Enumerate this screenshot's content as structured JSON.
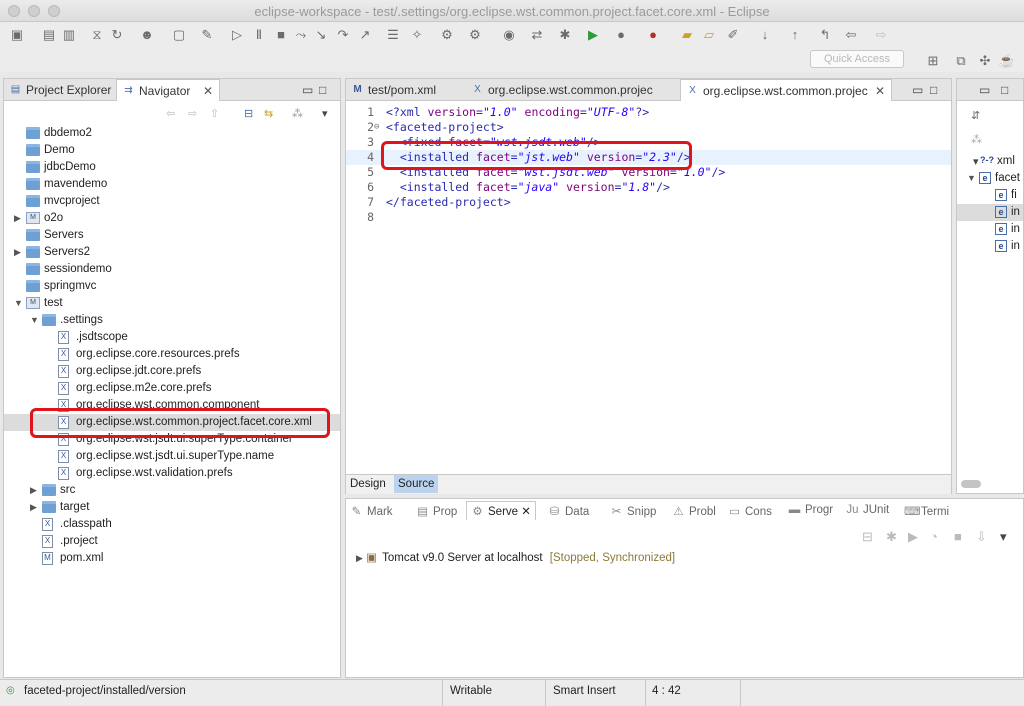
{
  "window": {
    "title": "eclipse-workspace - test/.settings/org.eclipse.wst.common.project.facet.core.xml - Eclipse"
  },
  "toolbar": {
    "quick_access_placeholder": "Quick Access"
  },
  "left_panel": {
    "tabs": [
      {
        "label": "Project Explorer",
        "active": false
      },
      {
        "label": "Navigator",
        "active": true
      }
    ],
    "tree": [
      {
        "label": "dbdemo2",
        "type": "folder",
        "indent": 0,
        "expanded": null
      },
      {
        "label": "Demo",
        "type": "folder",
        "indent": 0,
        "expanded": null
      },
      {
        "label": "jdbcDemo",
        "type": "folder",
        "indent": 0,
        "expanded": null
      },
      {
        "label": "mavendemo",
        "type": "folder",
        "indent": 0,
        "expanded": null
      },
      {
        "label": "mvcproject",
        "type": "folder",
        "indent": 0,
        "expanded": null
      },
      {
        "label": "o2o",
        "type": "project",
        "indent": 0,
        "expanded": false
      },
      {
        "label": "Servers",
        "type": "folder",
        "indent": 0,
        "expanded": null
      },
      {
        "label": "Servers2",
        "type": "folder",
        "indent": 0,
        "expanded": false
      },
      {
        "label": "sessiondemo",
        "type": "folder",
        "indent": 0,
        "expanded": null
      },
      {
        "label": "springmvc",
        "type": "folder",
        "indent": 0,
        "expanded": null
      },
      {
        "label": "test",
        "type": "project",
        "indent": 0,
        "expanded": true
      },
      {
        "label": ".settings",
        "type": "folder",
        "indent": 1,
        "expanded": true
      },
      {
        "label": ".jsdtscope",
        "type": "file",
        "indent": 2,
        "expanded": null
      },
      {
        "label": "org.eclipse.core.resources.prefs",
        "type": "file",
        "indent": 2,
        "expanded": null
      },
      {
        "label": "org.eclipse.jdt.core.prefs",
        "type": "file",
        "indent": 2,
        "expanded": null
      },
      {
        "label": "org.eclipse.m2e.core.prefs",
        "type": "file",
        "indent": 2,
        "expanded": null
      },
      {
        "label": "org.eclipse.wst.common.component",
        "type": "file",
        "indent": 2,
        "expanded": null
      },
      {
        "label": "org.eclipse.wst.common.project.facet.core.xml",
        "type": "file",
        "indent": 2,
        "expanded": null,
        "selected": true
      },
      {
        "label": "org.eclipse.wst.jsdt.ui.superType.container",
        "type": "file",
        "indent": 2,
        "expanded": null
      },
      {
        "label": "org.eclipse.wst.jsdt.ui.superType.name",
        "type": "file",
        "indent": 2,
        "expanded": null
      },
      {
        "label": "org.eclipse.wst.validation.prefs",
        "type": "file",
        "indent": 2,
        "expanded": null
      },
      {
        "label": "src",
        "type": "folder",
        "indent": 1,
        "expanded": false
      },
      {
        "label": "target",
        "type": "folder",
        "indent": 1,
        "expanded": false
      },
      {
        "label": ".classpath",
        "type": "file",
        "indent": 1,
        "expanded": null
      },
      {
        "label": ".project",
        "type": "file",
        "indent": 1,
        "expanded": null
      },
      {
        "label": "pom.xml",
        "type": "file",
        "indent": 1,
        "expanded": null
      }
    ]
  },
  "editor": {
    "tabs": [
      {
        "label": "test/pom.xml",
        "active": false
      },
      {
        "label": "org.eclipse.wst.common.projec",
        "active": false
      },
      {
        "label": "org.eclipse.wst.common.projec",
        "active": true
      }
    ],
    "lines": [
      {
        "n": "1",
        "parts": [
          [
            "tag",
            "<?xml "
          ],
          [
            "attr",
            "version"
          ],
          [
            "tag",
            "="
          ],
          [
            "val",
            "\"1.0\""
          ],
          [
            "tag",
            " "
          ],
          [
            "attr",
            "encoding"
          ],
          [
            "tag",
            "="
          ],
          [
            "val",
            "\"UTF-8\""
          ],
          [
            "tag",
            "?>"
          ]
        ]
      },
      {
        "n": "2",
        "parts": [
          [
            "tag",
            "<faceted-project>"
          ]
        ]
      },
      {
        "n": "3",
        "parts": [
          [
            "tag",
            "  <fixed "
          ],
          [
            "attr",
            "facet"
          ],
          [
            "tag",
            "="
          ],
          [
            "val",
            "\"wst.jsdt.web\""
          ],
          [
            "tag",
            "/>"
          ]
        ]
      },
      {
        "n": "4",
        "parts": [
          [
            "tag",
            "  <installed "
          ],
          [
            "attr",
            "facet"
          ],
          [
            "tag",
            "="
          ],
          [
            "val",
            "\"jst.web\""
          ],
          [
            "tag",
            " "
          ],
          [
            "attr",
            "version"
          ],
          [
            "tag",
            "="
          ],
          [
            "val",
            "\"2.3\""
          ],
          [
            "tag",
            "/>"
          ]
        ]
      },
      {
        "n": "5",
        "parts": [
          [
            "tag",
            "  <installed "
          ],
          [
            "attr",
            "facet"
          ],
          [
            "tag",
            "="
          ],
          [
            "val",
            "\"wst.jsdt.web\""
          ],
          [
            "tag",
            " "
          ],
          [
            "attr",
            "version"
          ],
          [
            "tag",
            "="
          ],
          [
            "val",
            "\"1.0\""
          ],
          [
            "tag",
            "/>"
          ]
        ]
      },
      {
        "n": "6",
        "parts": [
          [
            "tag",
            "  <installed "
          ],
          [
            "attr",
            "facet"
          ],
          [
            "tag",
            "="
          ],
          [
            "val",
            "\"java\""
          ],
          [
            "tag",
            " "
          ],
          [
            "attr",
            "version"
          ],
          [
            "tag",
            "="
          ],
          [
            "val",
            "\"1.8\""
          ],
          [
            "tag",
            "/>"
          ]
        ]
      },
      {
        "n": "7",
        "parts": [
          [
            "tag",
            "</faceted-project>"
          ]
        ]
      },
      {
        "n": "8",
        "parts": []
      }
    ],
    "bottom_tabs": {
      "design": "Design",
      "source": "Source"
    }
  },
  "bottom_panel": {
    "tabs": [
      {
        "label": "Mark",
        "icon": "✎"
      },
      {
        "label": "Prop",
        "icon": "▤"
      },
      {
        "label": "Serve",
        "icon": "⚙",
        "active": true
      },
      {
        "label": "Data",
        "icon": "⛁"
      },
      {
        "label": "Snipp",
        "icon": "✂"
      },
      {
        "label": "Probl",
        "icon": "⚠"
      },
      {
        "label": "Cons",
        "icon": "▭"
      },
      {
        "label": "Progr",
        "icon": "▬"
      },
      {
        "label": "JUnit",
        "icon": "Ju"
      },
      {
        "label": "Termi",
        "icon": "⌨"
      }
    ],
    "server": {
      "name": "Tomcat v9.0 Server at localhost",
      "state": "[Stopped, Synchronized]"
    }
  },
  "outline": {
    "items": [
      {
        "label": "xml",
        "icon": "?-?"
      },
      {
        "label": "facet",
        "icon": "e"
      },
      {
        "label": "fi",
        "icon": "e"
      },
      {
        "label": "in",
        "icon": "e"
      },
      {
        "label": "in",
        "icon": "e"
      },
      {
        "label": "in",
        "icon": "e"
      }
    ]
  },
  "status": {
    "path": "faceted-project/installed/version",
    "writable": "Writable",
    "insert_mode": "Smart Insert",
    "position": "4 : 42"
  }
}
